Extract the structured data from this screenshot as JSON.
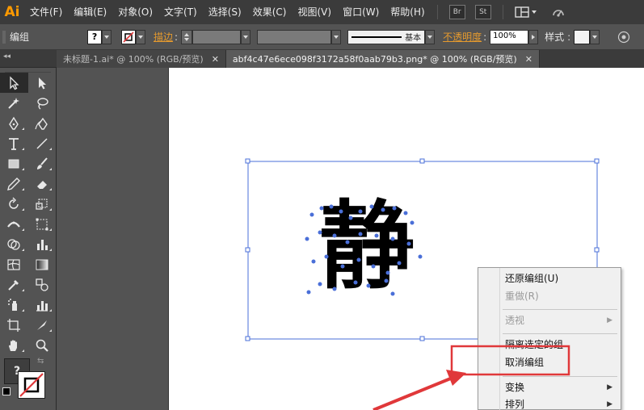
{
  "app": {
    "logo": "Ai"
  },
  "menubar": {
    "items": [
      "文件(F)",
      "编辑(E)",
      "对象(O)",
      "文字(T)",
      "选择(S)",
      "效果(C)",
      "视图(V)",
      "窗口(W)",
      "帮助(H)"
    ],
    "bridge_label": "Br",
    "stock_label": "St"
  },
  "controlbar": {
    "selection_label": "编组",
    "stroke_label": "描边",
    "stroke_style_label": "基本",
    "opacity_label": "不透明度",
    "opacity_value": "100%",
    "style_label": "样式"
  },
  "tabs": [
    {
      "label": "未标题-1.ai* @ 100% (RGB/预览)",
      "active": false
    },
    {
      "label": "abf4c47e6ece098f3172a58f0aab79b3.png* @ 100% (RGB/预览)",
      "active": true
    }
  ],
  "context_menu": {
    "items": [
      {
        "label": "还原编组(U)",
        "enabled": true,
        "submenu": false
      },
      {
        "label": "重做(R)",
        "enabled": false,
        "submenu": false
      },
      {
        "label": "透视",
        "enabled": false,
        "submenu": true
      },
      {
        "label": "隔离选定的组",
        "enabled": true,
        "submenu": false
      },
      {
        "label": "取消编组",
        "enabled": true,
        "submenu": false,
        "highlighted": true
      },
      {
        "label": "变换",
        "enabled": true,
        "submenu": true
      },
      {
        "label": "排列",
        "enabled": true,
        "submenu": true
      }
    ]
  },
  "colors": {
    "highlight_box": "#e0383a",
    "arrow": "#e0383a",
    "selection": "#4a6fd8",
    "accent_orange": "#ff9a00"
  },
  "artwork": {
    "character": "静"
  }
}
